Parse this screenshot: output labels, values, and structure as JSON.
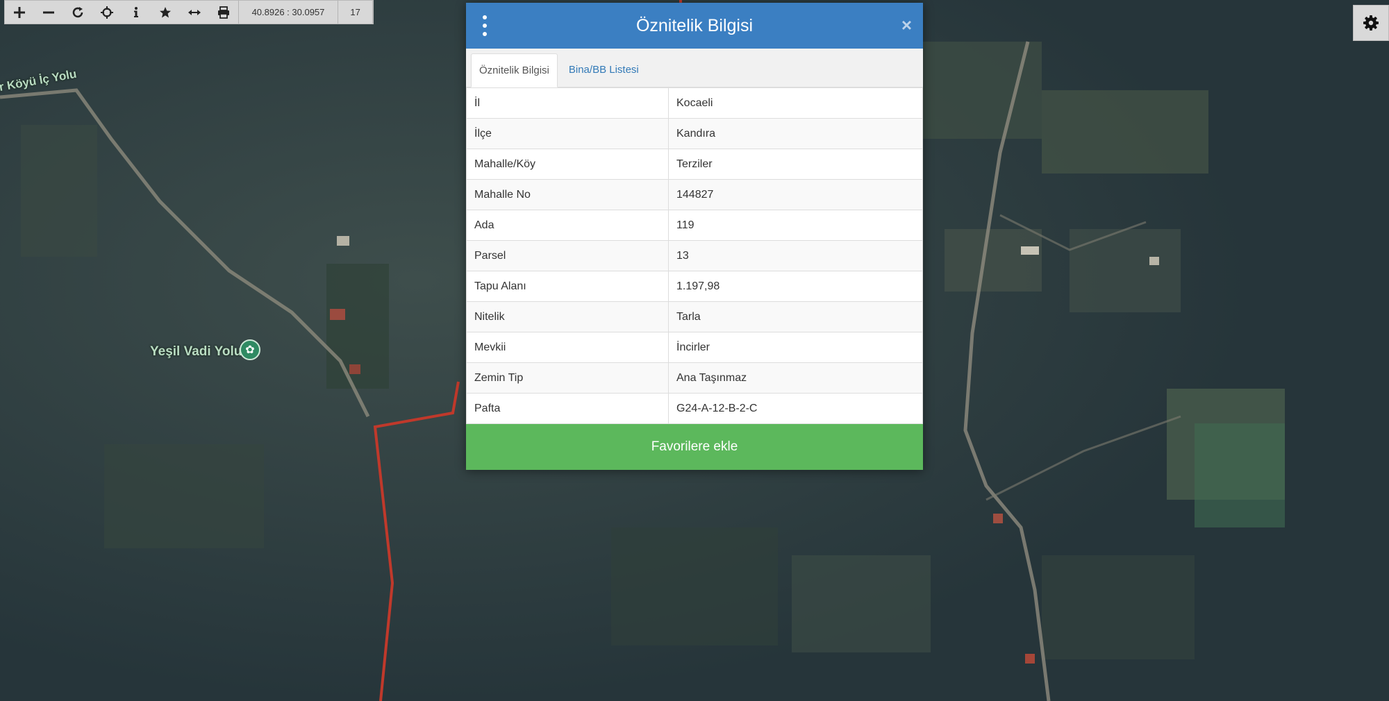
{
  "map": {
    "road_label": "er Köyü İç Yolu",
    "place_label": "Yeşil Vadi Yolu",
    "place_icon": "park-pin-icon"
  },
  "toolbar": {
    "buttons": [
      {
        "name": "zoom-in",
        "icon": "plus-icon"
      },
      {
        "name": "zoom-out",
        "icon": "minus-icon"
      },
      {
        "name": "refresh",
        "icon": "refresh-icon"
      },
      {
        "name": "locate",
        "icon": "crosshair-icon"
      },
      {
        "name": "info",
        "icon": "info-icon"
      },
      {
        "name": "favorite",
        "icon": "star-icon"
      },
      {
        "name": "measure",
        "icon": "horizontal-arrows-icon"
      },
      {
        "name": "print",
        "icon": "print-icon"
      }
    ],
    "coordinates": "40.8926 : 30.0957",
    "zoom_level": "17"
  },
  "settings": {
    "icon": "gear-icon"
  },
  "modal": {
    "title": "Öznitelik Bilgisi",
    "header_color": "#3b7fc2",
    "menu_icon": "vertical-dots-icon",
    "close_label": "×",
    "tabs": [
      {
        "label": "Öznitelik Bilgisi",
        "active": true
      },
      {
        "label": "Bina/BB Listesi",
        "active": false
      }
    ],
    "rows": [
      {
        "key": "İl",
        "value": "Kocaeli"
      },
      {
        "key": "İlçe",
        "value": "Kandıra"
      },
      {
        "key": "Mahalle/Köy",
        "value": "Terziler"
      },
      {
        "key": "Mahalle No",
        "value": "144827"
      },
      {
        "key": "Ada",
        "value": "119"
      },
      {
        "key": "Parsel",
        "value": "13"
      },
      {
        "key": "Tapu Alanı",
        "value": "1.197,98"
      },
      {
        "key": "Nitelik",
        "value": "Tarla"
      },
      {
        "key": "Mevkii",
        "value": "İncirler"
      },
      {
        "key": "Zemin Tip",
        "value": "Ana Taşınmaz"
      },
      {
        "key": "Pafta",
        "value": "G24-A-12-B-2-C"
      }
    ],
    "favorite_button": "Favorilere ekle",
    "favorite_color": "#5cb85c"
  }
}
